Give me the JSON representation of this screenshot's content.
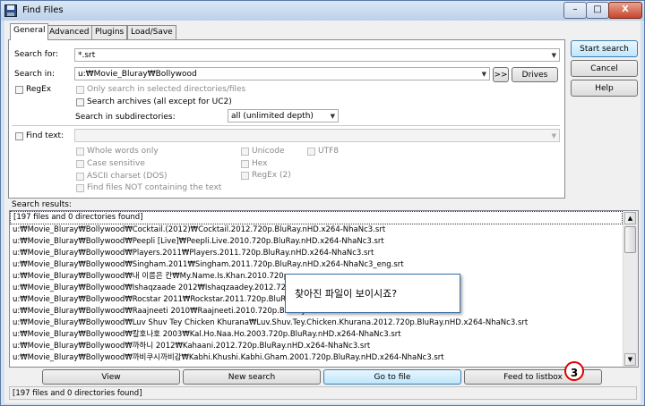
{
  "window": {
    "title": "Find Files",
    "minimize_label": "–",
    "maximize_label": "□",
    "close_label": "X"
  },
  "tabs": [
    "General",
    "Advanced",
    "Plugins",
    "Load/Save"
  ],
  "form": {
    "search_for_label": "Search for:",
    "search_for_value": "*.srt",
    "search_in_label": "Search in:",
    "search_in_value": "u:₩Movie_Bluray₩Bollywood",
    "browse_label": ">>",
    "drives_label": "Drives",
    "regex_label": "RegEx",
    "only_selected_label": "Only search in selected directories/files",
    "archives_label": "Search archives (all except for UC2)",
    "subdirs_label": "Search in subdirectories:",
    "subdirs_value": "all (unlimited depth)",
    "find_text_label": "Find text:",
    "find_text_value": "",
    "whole_words_label": "Whole words only",
    "case_sensitive_label": "Case sensitive",
    "ascii_label": "ASCII charset (DOS)",
    "not_containing_label": "Find files NOT containing the text",
    "unicode_label": "Unicode",
    "utf8_label": "UTF8",
    "hex_label": "Hex",
    "regex2_label": "RegEx (2)"
  },
  "right_buttons": {
    "start_search": "Start search",
    "cancel": "Cancel",
    "help": "Help"
  },
  "results": {
    "label": "Search results:",
    "rows": [
      "[197 files and 0 directories found]",
      "u:₩Movie_Bluray₩Bollywood₩Cocktail.(2012)₩Cocktail.2012.720p.BluRay.nHD.x264-NhaNc3.srt",
      "u:₩Movie_Bluray₩Bollywood₩Peepli [Live]₩Peepli.Live.2010.720p.BluRay.nHD.x264-NhaNc3.srt",
      "u:₩Movie_Bluray₩Bollywood₩Players.2011₩Players.2011.720p.BluRay.nHD.x264-NhaNc3.srt",
      "u:₩Movie_Bluray₩Bollywood₩Singham.2011₩Singham.2011.720p.BluRay.nHD.x264-NhaNc3_eng.srt",
      "u:₩Movie_Bluray₩Bollywood₩내 이름은 칸₩My.Name.Is.Khan.2010.720p",
      "u:₩Movie_Bluray₩Bollywood₩Ishaqzaade 2012₩Ishaqzaadey.2012.720p.B",
      "u:₩Movie_Bluray₩Bollywood₩Rocstar 2011₩Rockstar.2011.720p.BluRay.n",
      "u:₩Movie_Bluray₩Bollywood₩Raajneeti 2010₩Raajneeti.2010.720p.BluRay",
      "u:₩Movie_Bluray₩Bollywood₩Luv Shuv Tey Chicken Khurana₩Luv.Shuv.Tey.Chicken.Khurana.2012.720p.BluRay.nHD.x264-NhaNc3.srt",
      "u:₩Movie_Bluray₩Bollywood₩칼호나호 2003₩Kal.Ho.Naa.Ho.2003.720p.BluRay.nHD.x264-NhaNc3.srt",
      "u:₩Movie_Bluray₩Bollywood₩까하니 2012₩Kahaani.2012.720p.BluRay.nHD.x264-NhaNc3.srt",
      "u:₩Movie_Bluray₩Bollywood₩까비쿠시까비감₩Kabhi.Khushi.Kabhi.Gham.2001.720p.BluRay.nHD.x264-NhaNc3.srt"
    ]
  },
  "bottom_buttons": {
    "view": "View",
    "new_search": "New search",
    "go_to_file": "Go to file",
    "feed_to_listbox": "Feed to listbox"
  },
  "tooltip": "찾아진 파일이 보이시죠?",
  "annotation_number": "3",
  "status": "[197 files and 0 directories found]"
}
